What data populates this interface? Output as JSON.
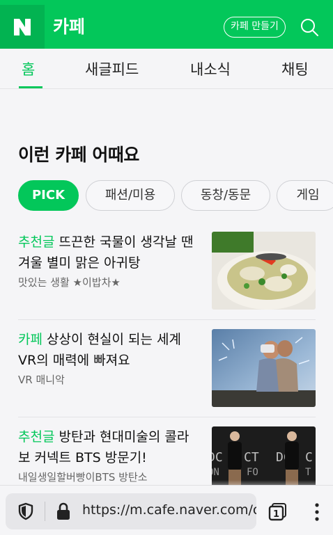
{
  "header": {
    "title": "카페",
    "make_cafe_button": "카페 만들기",
    "logo_letter": "N",
    "brand_color": "#03c75a"
  },
  "tabs": [
    {
      "label": "홈",
      "active": true
    },
    {
      "label": "새글피드",
      "active": false
    },
    {
      "label": "내소식",
      "active": false
    },
    {
      "label": "채팅",
      "active": false
    }
  ],
  "section": {
    "title": "이런 카페 어때요",
    "chips": [
      {
        "label": "PICK",
        "active": true
      },
      {
        "label": "패션/미용",
        "active": false
      },
      {
        "label": "동창/동문",
        "active": false
      },
      {
        "label": "게임",
        "active": false
      }
    ]
  },
  "items": [
    {
      "category": "추천글",
      "title": "뜨끈한 국물이 생각날 땐 겨울 별미 맑은 아귀탕",
      "sub": "맛있는 생활 ★이밥차★",
      "thumb": "fish-soup-image"
    },
    {
      "category": "카페",
      "title": "상상이 현실이 되는 세계 VR의 매력에 빠져요",
      "sub": "VR 매니악",
      "thumb": "vr-headset-image"
    },
    {
      "category": "추천글",
      "title": "방탄과 현대미술의 콜라보 커넥트 BTS 방문기!",
      "sub": "내일생일할버빵이BTS 방탄소",
      "thumb": "bts-exhibit-image"
    }
  ],
  "browser": {
    "url": "https://m.cafe.naver.com/ca",
    "tab_count": "1"
  }
}
